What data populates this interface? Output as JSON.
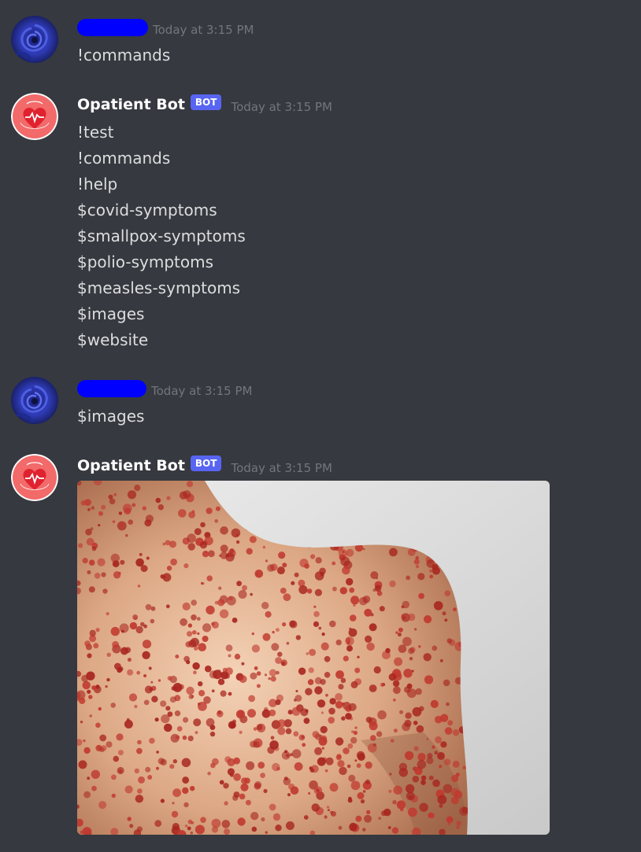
{
  "messages": [
    {
      "author": "",
      "author_redacted": true,
      "timestamp": "Today at 3:15 PM",
      "lines": [
        "!commands"
      ]
    },
    {
      "author": "Opatient Bot",
      "bot_tag": "BOT",
      "timestamp": "Today at 3:15 PM",
      "lines": [
        "!test",
        "!commands",
        "!help",
        "$covid-symptoms",
        "$smallpox-symptoms",
        "$polio-symptoms",
        "$measles-symptoms",
        "$images",
        "$website"
      ]
    },
    {
      "author": "",
      "author_redacted": true,
      "timestamp": "Today at 3:15 PM",
      "lines": [
        "$images"
      ]
    },
    {
      "author": "Opatient Bot",
      "bot_tag": "BOT",
      "timestamp": "Today at 3:15 PM",
      "attachment": "image"
    }
  ],
  "colors": {
    "background": "#36393f",
    "username": "#ffffff",
    "message_text": "#dcddde",
    "timestamp": "#72767d",
    "bot_tag": "#5865f2",
    "redaction": "#0000ff",
    "bot_avatar": "#f26a6a"
  },
  "icons": {
    "user_avatar": "blue-rose-avatar",
    "bot_avatar": "heart-pulse-logo-avatar"
  }
}
